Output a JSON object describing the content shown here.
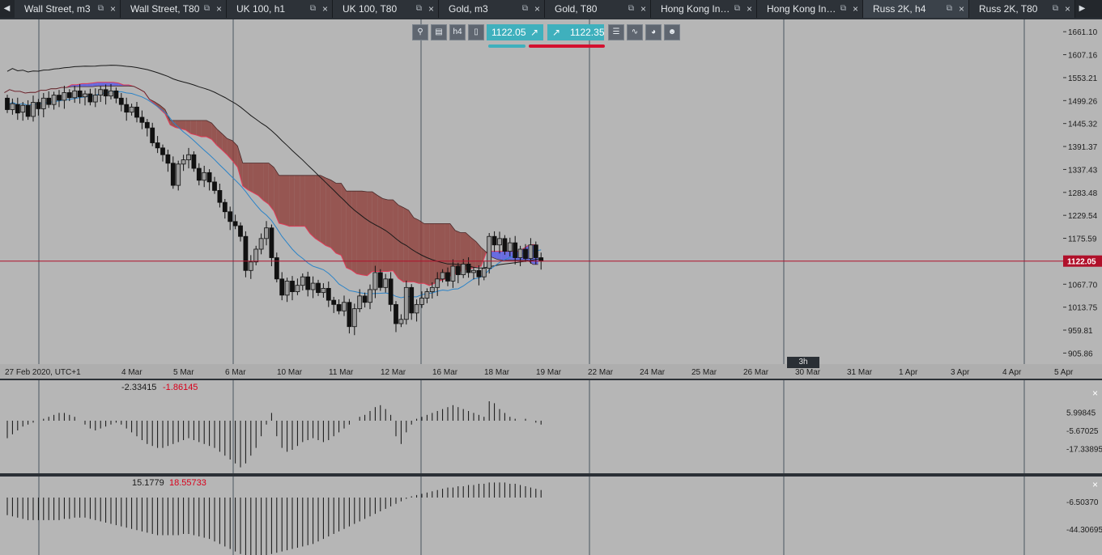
{
  "tabs": [
    {
      "label": "Wall Street, m3",
      "active": false
    },
    {
      "label": "Wall Street, T80",
      "active": false
    },
    {
      "label": "UK 100, h1",
      "active": false
    },
    {
      "label": "UK 100, T80",
      "active": false
    },
    {
      "label": "Gold, m3",
      "active": false
    },
    {
      "label": "Gold, T80",
      "active": false
    },
    {
      "label": "Hong Kong Ind…",
      "active": false
    },
    {
      "label": "Hong Kong Ind…",
      "active": false
    },
    {
      "label": "Russ 2K, h4",
      "active": true
    },
    {
      "label": "Russ 2K, T80",
      "active": false
    }
  ],
  "tab_close_glyph": "×",
  "tab_detach_glyph": "⧉",
  "tab_nav": {
    "left": "◀",
    "right": "▶"
  },
  "toolbar": {
    "timeframe": "h4",
    "sell_price": "1122.05",
    "buy_price": "1122.35",
    "icons": [
      "zoom-icon",
      "chart-settings-icon",
      "timeframe-button",
      "chart-type-icon",
      "indicator-list-icon",
      "indicators-icon",
      "sentiment-icon",
      "anonymous-icon"
    ]
  },
  "colors": {
    "plot_bg": "#b6b6b6",
    "sell_accent": "#3fb0bd",
    "buy_accent": "#d4102f",
    "cloud_bear": "#8f3e3a",
    "cloud_bull": "#5a5ee8",
    "price_line": "#b0102a"
  },
  "price_axis": {
    "ticks": [
      "1661.10",
      "1607.16",
      "1553.21",
      "1499.26",
      "1445.32",
      "1391.37",
      "1337.43",
      "1283.48",
      "1229.54",
      "1175.59",
      "1122.05",
      "1067.70",
      "1013.75",
      "959.81",
      "905.86"
    ],
    "current": "1122.05",
    "scale_label": "200 points"
  },
  "time_axis": {
    "labels": [
      "27 Feb 2020, UTC+1",
      "4 Mar",
      "5 Mar",
      "6 Mar",
      "10 Mar",
      "11 Mar",
      "12 Mar",
      "16 Mar",
      "18 Mar",
      "19 Mar",
      "22 Mar",
      "24 Mar",
      "25 Mar",
      "26 Mar",
      "30 Mar",
      "31 Mar",
      "1 Apr",
      "3 Apr",
      "4 Apr",
      "5 Apr"
    ],
    "badge": "3h"
  },
  "macd_pane": {
    "value_a": "-2.33415",
    "value_b": "-1.86145",
    "ticks": [
      "5.99845",
      "-5.67025",
      "-17.33895"
    ],
    "close": "×"
  },
  "osc_pane": {
    "value_a": "15.1779",
    "value_b": "18.55733",
    "ticks": [
      "-6.50370",
      "-44.30695"
    ],
    "close": "×"
  },
  "chart_data": {
    "type": "candlestick",
    "instrument": "Russ 2K, h4",
    "ylim": [
      880,
      1690
    ],
    "candles": [
      {
        "o": 1505,
        "c": 1478
      },
      {
        "o": 1478,
        "c": 1492
      },
      {
        "o": 1490,
        "c": 1470
      },
      {
        "o": 1472,
        "c": 1488
      },
      {
        "o": 1488,
        "c": 1462
      },
      {
        "o": 1462,
        "c": 1495
      },
      {
        "o": 1495,
        "c": 1480
      },
      {
        "o": 1480,
        "c": 1505
      },
      {
        "o": 1505,
        "c": 1490
      },
      {
        "o": 1490,
        "c": 1512
      },
      {
        "o": 1512,
        "c": 1500
      },
      {
        "o": 1500,
        "c": 1518
      },
      {
        "o": 1518,
        "c": 1506
      },
      {
        "o": 1506,
        "c": 1522
      },
      {
        "o": 1522,
        "c": 1508
      },
      {
        "o": 1508,
        "c": 1515
      },
      {
        "o": 1515,
        "c": 1496
      },
      {
        "o": 1496,
        "c": 1512
      },
      {
        "o": 1512,
        "c": 1525
      },
      {
        "o": 1525,
        "c": 1510
      },
      {
        "o": 1510,
        "c": 1522
      },
      {
        "o": 1522,
        "c": 1505
      },
      {
        "o": 1505,
        "c": 1490
      },
      {
        "o": 1490,
        "c": 1472
      },
      {
        "o": 1472,
        "c": 1484
      },
      {
        "o": 1484,
        "c": 1460
      },
      {
        "o": 1460,
        "c": 1448
      },
      {
        "o": 1448,
        "c": 1435
      },
      {
        "o": 1435,
        "c": 1400
      },
      {
        "o": 1400,
        "c": 1388
      },
      {
        "o": 1388,
        "c": 1372
      },
      {
        "o": 1372,
        "c": 1352
      },
      {
        "o": 1352,
        "c": 1300
      },
      {
        "o": 1300,
        "c": 1350
      },
      {
        "o": 1350,
        "c": 1360
      },
      {
        "o": 1360,
        "c": 1372
      },
      {
        "o": 1372,
        "c": 1340
      },
      {
        "o": 1340,
        "c": 1312
      },
      {
        "o": 1312,
        "c": 1330
      },
      {
        "o": 1330,
        "c": 1308
      },
      {
        "o": 1308,
        "c": 1288
      },
      {
        "o": 1288,
        "c": 1260
      },
      {
        "o": 1260,
        "c": 1238
      },
      {
        "o": 1238,
        "c": 1215
      },
      {
        "o": 1215,
        "c": 1205
      },
      {
        "o": 1205,
        "c": 1180
      },
      {
        "o": 1180,
        "c": 1100
      },
      {
        "o": 1100,
        "c": 1120
      },
      {
        "o": 1120,
        "c": 1150
      },
      {
        "o": 1150,
        "c": 1175
      },
      {
        "o": 1175,
        "c": 1200
      },
      {
        "o": 1200,
        "c": 1130
      },
      {
        "o": 1130,
        "c": 1080
      },
      {
        "o": 1080,
        "c": 1042
      },
      {
        "o": 1042,
        "c": 1075
      },
      {
        "o": 1075,
        "c": 1050
      },
      {
        "o": 1050,
        "c": 1065
      },
      {
        "o": 1065,
        "c": 1085
      },
      {
        "o": 1085,
        "c": 1055
      },
      {
        "o": 1055,
        "c": 1070
      },
      {
        "o": 1070,
        "c": 1048
      },
      {
        "o": 1048,
        "c": 1058
      },
      {
        "o": 1058,
        "c": 1030
      },
      {
        "o": 1030,
        "c": 1020
      },
      {
        "o": 1020,
        "c": 1005
      },
      {
        "o": 1005,
        "c": 1025
      },
      {
        "o": 1025,
        "c": 968
      },
      {
        "o": 968,
        "c": 1010
      },
      {
        "o": 1010,
        "c": 1040
      },
      {
        "o": 1040,
        "c": 1025
      },
      {
        "o": 1025,
        "c": 1055
      },
      {
        "o": 1055,
        "c": 1095
      },
      {
        "o": 1095,
        "c": 1060
      },
      {
        "o": 1060,
        "c": 1080
      },
      {
        "o": 1080,
        "c": 1020
      },
      {
        "o": 1020,
        "c": 975
      },
      {
        "o": 975,
        "c": 985
      },
      {
        "o": 985,
        "c": 1060
      },
      {
        "o": 1060,
        "c": 1000
      },
      {
        "o": 1000,
        "c": 1020
      },
      {
        "o": 1020,
        "c": 1035
      },
      {
        "o": 1035,
        "c": 1050
      },
      {
        "o": 1050,
        "c": 1060
      },
      {
        "o": 1060,
        "c": 1080
      },
      {
        "o": 1080,
        "c": 1095
      },
      {
        "o": 1095,
        "c": 1075
      },
      {
        "o": 1075,
        "c": 1110
      },
      {
        "o": 1110,
        "c": 1090
      },
      {
        "o": 1090,
        "c": 1115
      },
      {
        "o": 1115,
        "c": 1095
      },
      {
        "o": 1095,
        "c": 1100
      },
      {
        "o": 1100,
        "c": 1085
      },
      {
        "o": 1085,
        "c": 1105
      },
      {
        "o": 1105,
        "c": 1180
      },
      {
        "o": 1180,
        "c": 1160
      },
      {
        "o": 1160,
        "c": 1175
      },
      {
        "o": 1175,
        "c": 1145
      },
      {
        "o": 1145,
        "c": 1165
      },
      {
        "o": 1165,
        "c": 1130
      },
      {
        "o": 1130,
        "c": 1150
      },
      {
        "o": 1150,
        "c": 1128
      },
      {
        "o": 1128,
        "c": 1160
      },
      {
        "o": 1160,
        "c": 1130
      },
      {
        "o": 1130,
        "c": 1122
      }
    ],
    "macd_hist": [
      -9,
      -7,
      -5,
      -3,
      -2,
      -1,
      0,
      1,
      2,
      3,
      4,
      4,
      3,
      2,
      0,
      -2,
      -4,
      -5,
      -4,
      -3,
      -2,
      -1,
      -2,
      -4,
      -6,
      -8,
      -10,
      -12,
      -13,
      -14,
      -14,
      -13,
      -12,
      -11,
      -10,
      -9,
      -10,
      -11,
      -12,
      -13,
      -14,
      -16,
      -18,
      -20,
      -22,
      -24,
      -22,
      -18,
      -14,
      -8,
      -2,
      4,
      -8,
      -14,
      -16,
      -15,
      -13,
      -11,
      -10,
      -9,
      -10,
      -11,
      -10,
      -8,
      -6,
      -4,
      -2,
      0,
      2,
      3,
      5,
      7,
      8,
      6,
      3,
      -8,
      -12,
      -6,
      -2,
      1,
      2,
      3,
      4,
      5,
      6,
      7,
      8,
      7,
      6,
      5,
      4,
      3,
      2,
      10,
      9,
      6,
      4,
      2,
      1,
      0,
      1,
      0,
      -1,
      -2
    ],
    "osc_hist": [
      -14,
      -15,
      -16,
      -17,
      -18,
      -18,
      -18,
      -18,
      -18,
      -18,
      -18,
      -17,
      -17,
      -16,
      -16,
      -16,
      -17,
      -18,
      -19,
      -20,
      -21,
      -22,
      -23,
      -24,
      -25,
      -26,
      -27,
      -28,
      -29,
      -30,
      -30,
      -30,
      -30,
      -30,
      -29,
      -29,
      -30,
      -31,
      -32,
      -33,
      -35,
      -37,
      -39,
      -41,
      -43,
      -45,
      -47,
      -48,
      -48,
      -47,
      -46,
      -45,
      -44,
      -43,
      -42,
      -41,
      -40,
      -39,
      -38,
      -37,
      -35,
      -33,
      -31,
      -29,
      -27,
      -25,
      -23,
      -21,
      -19,
      -17,
      -15,
      -13,
      -11,
      -9,
      -7,
      -5,
      -3,
      -1,
      1,
      2,
      3,
      4,
      5,
      6,
      7,
      8,
      8,
      9,
      9,
      10,
      10,
      11,
      11,
      12,
      12,
      12,
      12,
      11,
      11,
      10,
      9,
      8,
      7,
      6
    ]
  }
}
